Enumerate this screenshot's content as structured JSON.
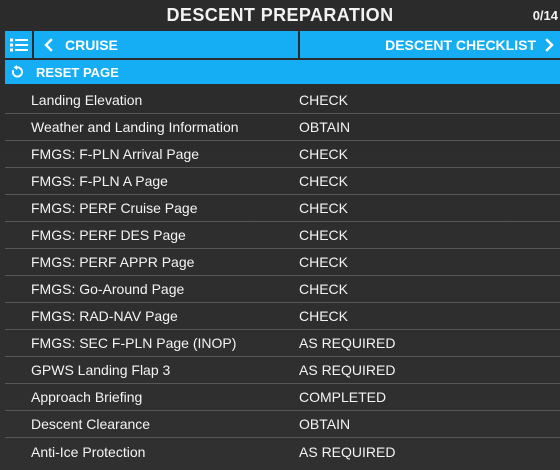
{
  "header": {
    "title": "DESCENT PREPARATION",
    "progress": "0/14"
  },
  "nav": {
    "menu_icon": "list-icon",
    "prev_label": "CRUISE",
    "next_label": "DESCENT CHECKLIST"
  },
  "reset": {
    "label": "RESET PAGE",
    "icon": "reset-icon"
  },
  "checklist": {
    "items": [
      {
        "item": "Landing Elevation",
        "action": "CHECK"
      },
      {
        "item": "Weather and Landing Information",
        "action": "OBTAIN"
      },
      {
        "item": "FMGS: F-PLN Arrival Page",
        "action": "CHECK"
      },
      {
        "item": "FMGS: F-PLN A Page",
        "action": "CHECK"
      },
      {
        "item": "FMGS: PERF Cruise Page",
        "action": "CHECK"
      },
      {
        "item": "FMGS: PERF DES Page",
        "action": "CHECK"
      },
      {
        "item": "FMGS: PERF APPR Page",
        "action": "CHECK"
      },
      {
        "item": "FMGS: Go-Around Page",
        "action": "CHECK"
      },
      {
        "item": "FMGS: RAD-NAV Page",
        "action": "CHECK"
      },
      {
        "item": "FMGS: SEC F-PLN Page (INOP)",
        "action": "AS REQUIRED"
      },
      {
        "item": "GPWS Landing Flap 3",
        "action": "AS REQUIRED"
      },
      {
        "item": "Approach Briefing",
        "action": "COMPLETED"
      },
      {
        "item": "Descent Clearance",
        "action": "OBTAIN"
      },
      {
        "item": "Anti-Ice Protection",
        "action": "AS REQUIRED"
      }
    ]
  },
  "colors": {
    "accent": "#15aef5",
    "background": "#2c2c2c",
    "divider": "#575757",
    "text": "#ffffff"
  }
}
